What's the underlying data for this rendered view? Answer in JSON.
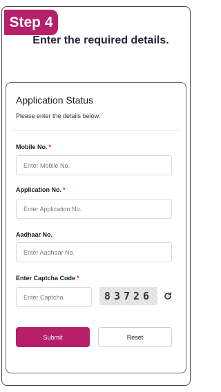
{
  "step": {
    "label": "Step 4"
  },
  "header": {
    "subtitle": "Enter the required details."
  },
  "card": {
    "title": "Application Status",
    "description": "Please enter the details below."
  },
  "fields": {
    "mobile": {
      "label": "Mobile No.",
      "required_mark": "*",
      "placeholder": "Enter Mobile No."
    },
    "application": {
      "label": "Application No.",
      "required_mark": "*",
      "placeholder": "Enter Application No."
    },
    "aadhaar": {
      "label": "Aadhaar No.",
      "placeholder": "Enter Aadhaar No."
    },
    "captcha": {
      "label": "Enter Captcha Code",
      "required_mark": "*",
      "placeholder": "Enter Captcha",
      "code": "83726",
      "refresh_icon": "refresh-icon"
    }
  },
  "actions": {
    "submit_label": "Submit",
    "reset_label": "Reset"
  },
  "colors": {
    "accent": "#b81f6a",
    "required": "#c2185b",
    "border": "#d9d9d9"
  }
}
